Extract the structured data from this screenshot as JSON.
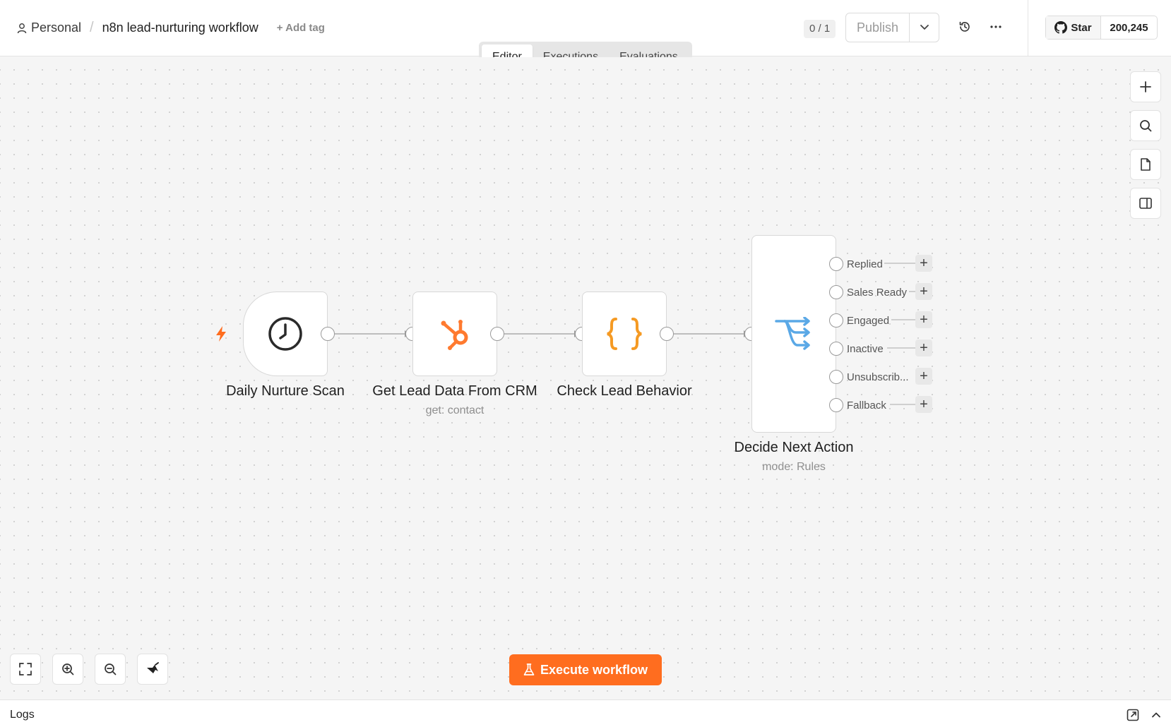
{
  "header": {
    "breadcrumb_project": "Personal",
    "breadcrumb_separator": "/",
    "workflow_name": "n8n lead-nurturing workflow",
    "add_tag": "+ Add tag",
    "version_counter": "0 / 1",
    "publish_label": "Publish",
    "github_star_label": "Star",
    "github_star_count": "200,245"
  },
  "tabs": [
    {
      "label": "Editor",
      "active": true
    },
    {
      "label": "Executions",
      "active": false
    },
    {
      "label": "Evaluations",
      "active": false
    }
  ],
  "nodes": [
    {
      "name": "Daily Nurture Scan",
      "subtitle": "",
      "icon": "clock-icon",
      "trigger": true
    },
    {
      "name": "Get Lead Data From CRM",
      "subtitle": "get: contact",
      "icon": "hubspot-icon"
    },
    {
      "name": "Check Lead Behavior",
      "subtitle": "",
      "icon": "code-braces-icon"
    },
    {
      "name": "Decide Next Action",
      "subtitle": "mode: Rules",
      "icon": "switch-icon"
    }
  ],
  "switch_outputs": [
    "Replied",
    "Sales Ready",
    "Engaged",
    "Inactive",
    "Unsubscrib...",
    "Fallback"
  ],
  "execute_button": "Execute workflow",
  "logs_title": "Logs",
  "colors": {
    "accent": "#ff6d1f",
    "hubspot": "#ff7a2f",
    "code": "#f59a23",
    "switch": "#5aa8e6",
    "trigger_bolt": "#ff6d1f"
  }
}
